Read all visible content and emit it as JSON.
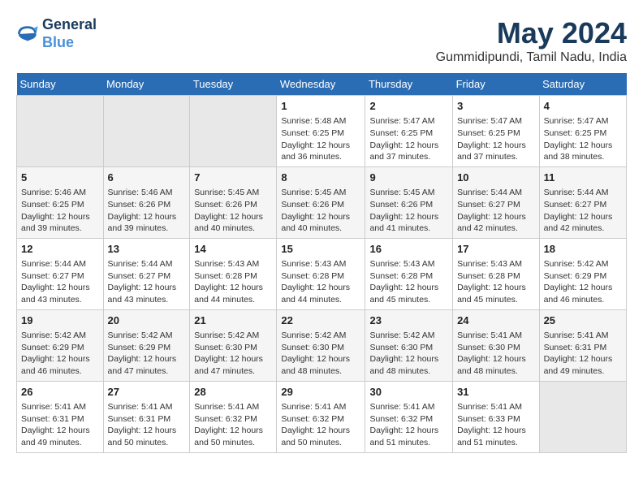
{
  "logo": {
    "line1": "General",
    "line2": "Blue"
  },
  "title": "May 2024",
  "location": "Gummidipundi, Tamil Nadu, India",
  "headers": [
    "Sunday",
    "Monday",
    "Tuesday",
    "Wednesday",
    "Thursday",
    "Friday",
    "Saturday"
  ],
  "weeks": [
    [
      {
        "day": "",
        "info": ""
      },
      {
        "day": "",
        "info": ""
      },
      {
        "day": "",
        "info": ""
      },
      {
        "day": "1",
        "info": "Sunrise: 5:48 AM\nSunset: 6:25 PM\nDaylight: 12 hours\nand 36 minutes."
      },
      {
        "day": "2",
        "info": "Sunrise: 5:47 AM\nSunset: 6:25 PM\nDaylight: 12 hours\nand 37 minutes."
      },
      {
        "day": "3",
        "info": "Sunrise: 5:47 AM\nSunset: 6:25 PM\nDaylight: 12 hours\nand 37 minutes."
      },
      {
        "day": "4",
        "info": "Sunrise: 5:47 AM\nSunset: 6:25 PM\nDaylight: 12 hours\nand 38 minutes."
      }
    ],
    [
      {
        "day": "5",
        "info": "Sunrise: 5:46 AM\nSunset: 6:25 PM\nDaylight: 12 hours\nand 39 minutes."
      },
      {
        "day": "6",
        "info": "Sunrise: 5:46 AM\nSunset: 6:26 PM\nDaylight: 12 hours\nand 39 minutes."
      },
      {
        "day": "7",
        "info": "Sunrise: 5:45 AM\nSunset: 6:26 PM\nDaylight: 12 hours\nand 40 minutes."
      },
      {
        "day": "8",
        "info": "Sunrise: 5:45 AM\nSunset: 6:26 PM\nDaylight: 12 hours\nand 40 minutes."
      },
      {
        "day": "9",
        "info": "Sunrise: 5:45 AM\nSunset: 6:26 PM\nDaylight: 12 hours\nand 41 minutes."
      },
      {
        "day": "10",
        "info": "Sunrise: 5:44 AM\nSunset: 6:27 PM\nDaylight: 12 hours\nand 42 minutes."
      },
      {
        "day": "11",
        "info": "Sunrise: 5:44 AM\nSunset: 6:27 PM\nDaylight: 12 hours\nand 42 minutes."
      }
    ],
    [
      {
        "day": "12",
        "info": "Sunrise: 5:44 AM\nSunset: 6:27 PM\nDaylight: 12 hours\nand 43 minutes."
      },
      {
        "day": "13",
        "info": "Sunrise: 5:44 AM\nSunset: 6:27 PM\nDaylight: 12 hours\nand 43 minutes."
      },
      {
        "day": "14",
        "info": "Sunrise: 5:43 AM\nSunset: 6:28 PM\nDaylight: 12 hours\nand 44 minutes."
      },
      {
        "day": "15",
        "info": "Sunrise: 5:43 AM\nSunset: 6:28 PM\nDaylight: 12 hours\nand 44 minutes."
      },
      {
        "day": "16",
        "info": "Sunrise: 5:43 AM\nSunset: 6:28 PM\nDaylight: 12 hours\nand 45 minutes."
      },
      {
        "day": "17",
        "info": "Sunrise: 5:43 AM\nSunset: 6:28 PM\nDaylight: 12 hours\nand 45 minutes."
      },
      {
        "day": "18",
        "info": "Sunrise: 5:42 AM\nSunset: 6:29 PM\nDaylight: 12 hours\nand 46 minutes."
      }
    ],
    [
      {
        "day": "19",
        "info": "Sunrise: 5:42 AM\nSunset: 6:29 PM\nDaylight: 12 hours\nand 46 minutes."
      },
      {
        "day": "20",
        "info": "Sunrise: 5:42 AM\nSunset: 6:29 PM\nDaylight: 12 hours\nand 47 minutes."
      },
      {
        "day": "21",
        "info": "Sunrise: 5:42 AM\nSunset: 6:30 PM\nDaylight: 12 hours\nand 47 minutes."
      },
      {
        "day": "22",
        "info": "Sunrise: 5:42 AM\nSunset: 6:30 PM\nDaylight: 12 hours\nand 48 minutes."
      },
      {
        "day": "23",
        "info": "Sunrise: 5:42 AM\nSunset: 6:30 PM\nDaylight: 12 hours\nand 48 minutes."
      },
      {
        "day": "24",
        "info": "Sunrise: 5:41 AM\nSunset: 6:30 PM\nDaylight: 12 hours\nand 48 minutes."
      },
      {
        "day": "25",
        "info": "Sunrise: 5:41 AM\nSunset: 6:31 PM\nDaylight: 12 hours\nand 49 minutes."
      }
    ],
    [
      {
        "day": "26",
        "info": "Sunrise: 5:41 AM\nSunset: 6:31 PM\nDaylight: 12 hours\nand 49 minutes."
      },
      {
        "day": "27",
        "info": "Sunrise: 5:41 AM\nSunset: 6:31 PM\nDaylight: 12 hours\nand 50 minutes."
      },
      {
        "day": "28",
        "info": "Sunrise: 5:41 AM\nSunset: 6:32 PM\nDaylight: 12 hours\nand 50 minutes."
      },
      {
        "day": "29",
        "info": "Sunrise: 5:41 AM\nSunset: 6:32 PM\nDaylight: 12 hours\nand 50 minutes."
      },
      {
        "day": "30",
        "info": "Sunrise: 5:41 AM\nSunset: 6:32 PM\nDaylight: 12 hours\nand 51 minutes."
      },
      {
        "day": "31",
        "info": "Sunrise: 5:41 AM\nSunset: 6:33 PM\nDaylight: 12 hours\nand 51 minutes."
      },
      {
        "day": "",
        "info": ""
      }
    ]
  ]
}
